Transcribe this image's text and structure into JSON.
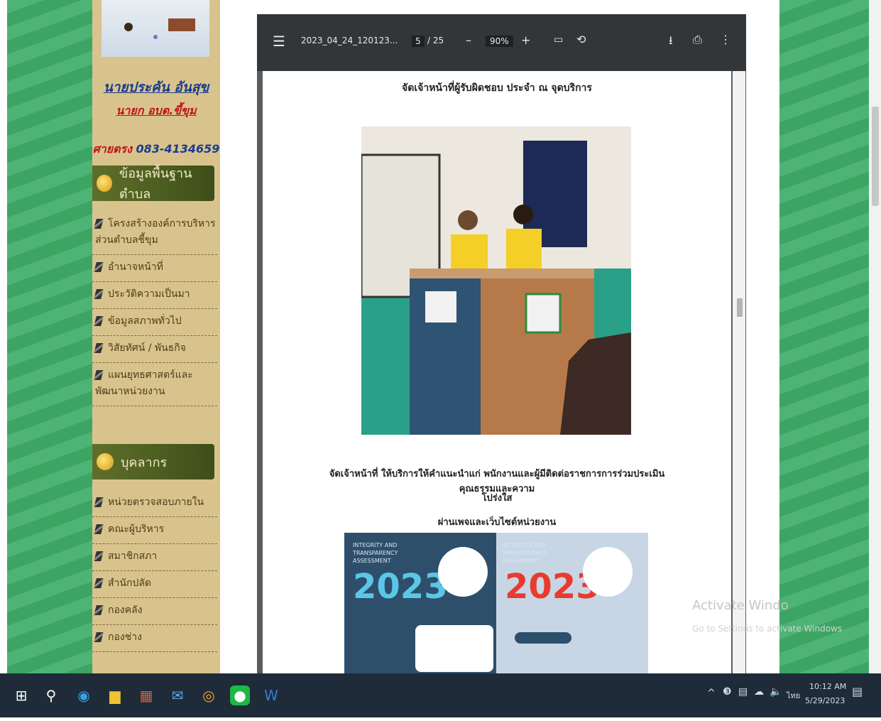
{
  "sidebar": {
    "name": "นายประคัน อันสุข",
    "title": "นายก อบต.ขี้ขุม",
    "phone_label": "ศายตรง",
    "phone_number": "083-4134659",
    "section1_title": "ข้อมูลพื้นฐานตำบล",
    "section1_items": [
      "โครงสร้างองค์การบริหารส่วนตำบลชี้ขุม",
      "อำนาจหน้าที่",
      "ประวัติความเป็นมา",
      "ข้อมูลสภาพทั่วไป",
      "วิสัยทัศน์ / พันธกิจ",
      "แผนยุทธศาสตร์และพัฒนาหน่วยงาน"
    ],
    "section2_title": "บุคลากร",
    "section2_items": [
      "หน่วยตรวจสอบภายใน",
      "คณะผู้บริหาร",
      "สมาชิกสภา",
      "สำนักปลัด",
      "กองคลัง",
      "กองช่าง"
    ]
  },
  "pdf_toolbar": {
    "filename": "2023_04_24_120123...",
    "page_current": "5",
    "page_total": "/ 25",
    "zoom": "90%",
    "minus": "–",
    "plus": "+"
  },
  "pdf_page": {
    "heading": "จัดเจ้าหน้าที่ผู้รับผิดชอบ ประจำ ณ จุดบริการ",
    "paragraph_line1": "จัดเจ้าหน้าที่ ให้บริการให้คำแนะนำแก่ พนักงานและผู้มีติดต่อราชการการร่วมประเมินคุณธรรมและความ",
    "paragraph_line2": "โปร่งใส",
    "paragraph_line3": "ผ่านเพจและเว็บไซต์หน่วยงาน",
    "poster_caption1": "INTEGRITY AND TRANSPARENCY ASSESSMENT",
    "poster_year": "2023"
  },
  "watermark": {
    "line1": "Activate Windo",
    "line2": "Go to Settings to activate Windows"
  },
  "taskbar": {
    "time": "10:12 AM",
    "date": "5/29/2023",
    "lang": "ไทย"
  }
}
